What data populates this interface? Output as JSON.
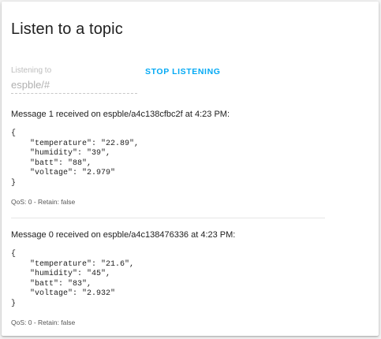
{
  "card": {
    "title": "Listen to a topic"
  },
  "listen": {
    "label": "Listening to",
    "value": "espble/#",
    "stop_label": "STOP LISTENING"
  },
  "messages": [
    {
      "header": "Message 1 received on espble/a4c138cfbc2f at 4:23 PM:",
      "payload": "{\n    \"temperature\": \"22.89\",\n    \"humidity\": \"39\",\n    \"batt\": \"88\",\n    \"voltage\": \"2.979\"\n}",
      "meta": "QoS: 0 - Retain: false"
    },
    {
      "header": "Message 0 received on espble/a4c138476336 at 4:23 PM:",
      "payload": "{\n    \"temperature\": \"21.6\",\n    \"humidity\": \"45\",\n    \"batt\": \"83\",\n    \"voltage\": \"2.932\"\n}",
      "meta": "QoS: 0 - Retain: false"
    }
  ],
  "colors": {
    "accent": "#03a9f4",
    "text": "#212121",
    "muted": "#bdbdbd"
  }
}
